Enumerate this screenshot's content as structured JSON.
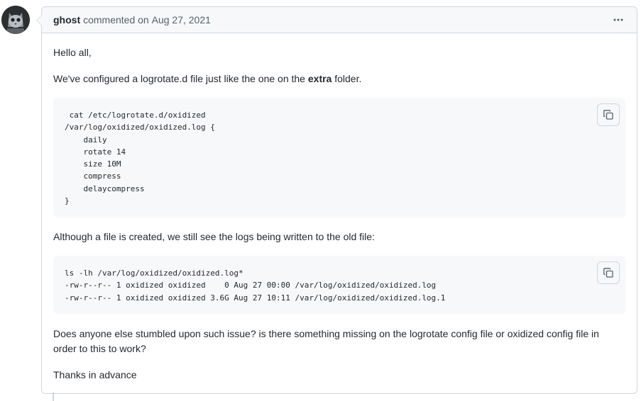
{
  "comment": {
    "author": "ghost",
    "action": "commented on",
    "date": "Aug 27, 2021",
    "menu_icon": "kebab-horizontal-icon",
    "paragraphs": {
      "greeting": "Hello all,",
      "intro_before": "We've configured a logrotate.d file just like the one on the",
      "intro_bold": "extra",
      "intro_after": "folder.",
      "observation": "Although a file is created, we still see the logs being written to the old file:",
      "question": "Does anyone else stumbled upon such issue? is there something missing on the logrotate config file or oxidized config file in order to this to work?",
      "thanks": "Thanks in advance"
    },
    "code_blocks": [
      {
        "text": " cat /etc/logrotate.d/oxidized\n/var/log/oxidized/oxidized.log {\n    daily\n    rotate 14\n    size 10M\n    compress\n    delaycompress\n}",
        "copy_icon": "copy-icon"
      },
      {
        "text": "ls -lh /var/log/oxidized/oxidized.log*\n-rw-r--r-- 1 oxidized oxidized    0 Aug 27 00:00 /var/log/oxidized/oxidized.log\n-rw-r--r-- 1 oxidized oxidized 3.6G Aug 27 10:11 /var/log/oxidized/oxidized.log.1",
        "copy_icon": "copy-icon"
      }
    ]
  }
}
